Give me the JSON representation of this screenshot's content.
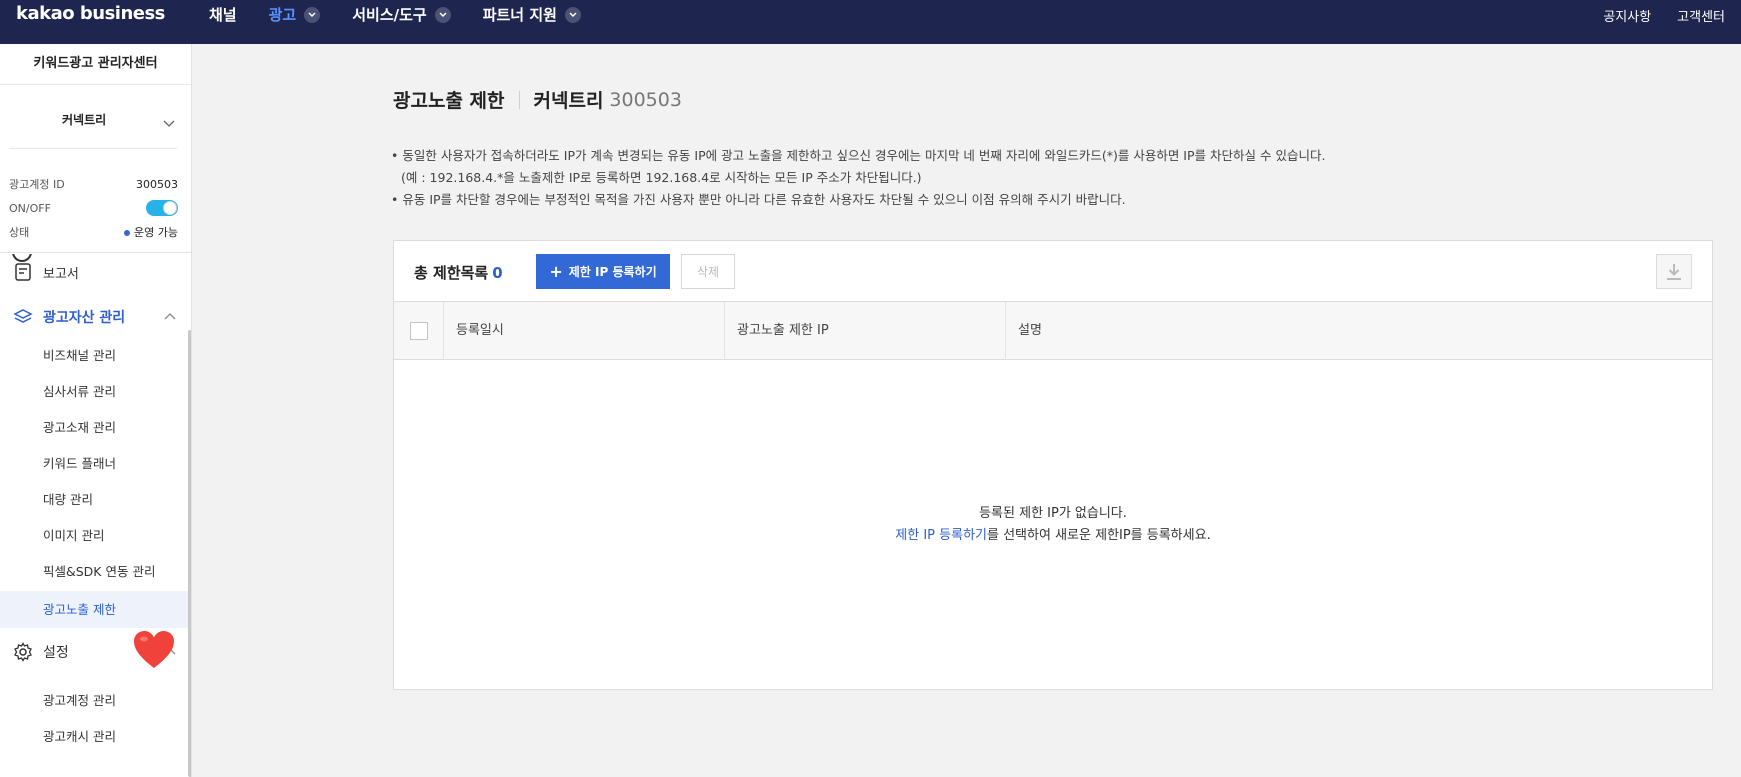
{
  "topbar": {
    "logo": "kakao business",
    "nav": [
      {
        "label": "채널"
      },
      {
        "label": "광고"
      },
      {
        "label": "서비스/도구"
      },
      {
        "label": "파트너 지원"
      }
    ],
    "right": [
      "공지사항",
      "고객센터"
    ]
  },
  "sidebar": {
    "title": "키워드광고 관리자센터",
    "account_name": "커넥트리",
    "info": {
      "id_label": "광고계정 ID",
      "id_value": "300503",
      "onoff_label": "ON/OFF",
      "status_label": "상태",
      "status_value": "운영 가능"
    },
    "menu": {
      "report": "보고서",
      "assets": "광고자산 관리",
      "asset_items": [
        "비즈채널 관리",
        "심사서류 관리",
        "광고소재 관리",
        "키워드 플래너",
        "대량 관리",
        "이미지 관리",
        "픽셀&SDK 연동 관리",
        "광고노출 제한"
      ],
      "settings": "설정",
      "settings_items": [
        "광고계정 관리",
        "광고캐시 관리"
      ]
    }
  },
  "main": {
    "title": "광고노출 제한",
    "account_name": "커넥트리",
    "account_id": "300503",
    "notes": [
      "동일한 사용자가 접속하더라도 IP가 계속 변경되는 유동 IP에 광고 노출을 제한하고 싶으신 경우에는 마지막 네 번째 자리에 와일드카드(*)를 사용하면 IP를 차단하실 수 있습니다.",
      "(예 : 192.168.4.*을 노출제한 IP로 등록하면 192.168.4로 시작하는 모든 IP 주소가 차단됩니다.)",
      "유동 IP를 차단할 경우에는 부정적인 목적을 가진 사용자 뿐만 아니라 다른 유효한 사용자도 차단될 수 있으니 이점 유의해 주시기 바랍니다."
    ],
    "total_label": "총 제한목록",
    "total_count": "0",
    "register_button": "제한 IP 등록하기",
    "delete_button": "삭제",
    "columns": [
      "등록일시",
      "광고노출 제한 IP",
      "설명"
    ],
    "empty_line1": "등록된 제한 IP가 없습니다.",
    "empty_link": "제한 IP 등록하기",
    "empty_rest": "를 선택하여 새로운 제한IP를 등록하세요."
  },
  "colors": {
    "topbar": "#1e2650",
    "accent": "#3269d6",
    "active_nav": "#5a93ff",
    "toggle": "#26b3e8"
  }
}
